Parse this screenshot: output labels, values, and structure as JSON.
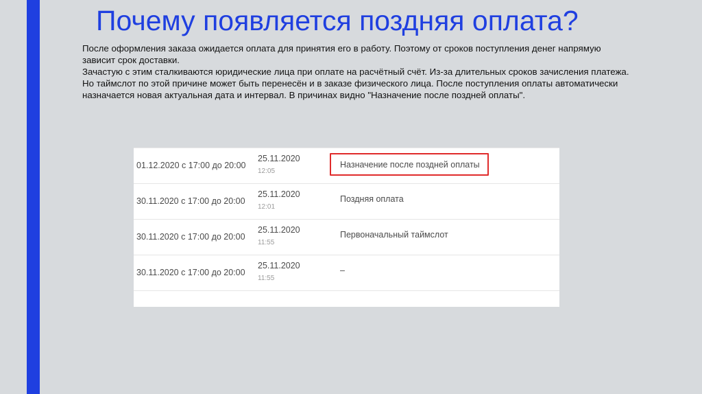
{
  "slide": {
    "title": "Почему появляется поздняя оплата?",
    "paragraphs": [
      "После оформления заказа ожидается оплата для принятия его в работу. Поэтому от сроков поступления денег напрямую зависит срок доставки.",
      "Зачастую с этим сталкиваются юридические лица при оплате на расчётный счёт. Из-за длительных сроков зачисления платежа.",
      "Но таймслот по этой причине может быть перенесён и в заказе физического лица. После поступления оплаты автоматически назначается новая актуальная дата и интервал. В причинах видно \"Назначение после поздней оплаты\"."
    ]
  },
  "history_table": {
    "rows": [
      {
        "interval": "01.12.2020 с 17:00 до 20:00",
        "date": "25.11.2020",
        "time": "12:05",
        "reason": "Назначение после поздней оплаты",
        "highlighted": true
      },
      {
        "interval": "30.11.2020 с 17:00 до 20:00",
        "date": "25.11.2020",
        "time": "12:01",
        "reason": "Поздняя оплата",
        "highlighted": false
      },
      {
        "interval": "30.11.2020 с 17:00 до 20:00",
        "date": "25.11.2020",
        "time": "11:55",
        "reason": "Первоначальный таймслот",
        "highlighted": false
      },
      {
        "interval": "30.11.2020 с 17:00 до 20:00",
        "date": "25.11.2020",
        "time": "11:55",
        "reason": "–",
        "highlighted": false
      }
    ]
  },
  "colors": {
    "accent": "#1f3fe0",
    "highlight_border": "#e02b2b",
    "background": "#d7dadd"
  }
}
